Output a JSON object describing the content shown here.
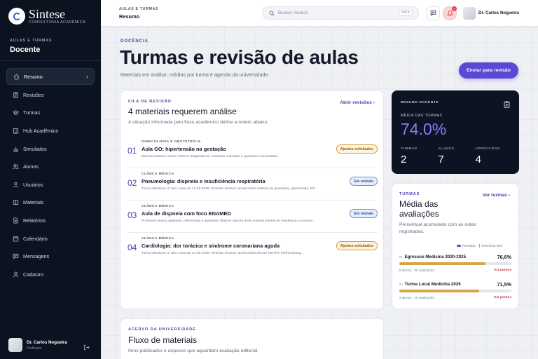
{
  "brand": {
    "name": "Sintese",
    "subtitle": "CONSULTORIA ACADÊMICA"
  },
  "sidebar": {
    "eyebrow": "AULAS E TURMAS",
    "role": "Docente",
    "items": [
      {
        "label": "Resumo",
        "icon": "home-icon",
        "active": true
      },
      {
        "label": "Revisões",
        "icon": "clipboard-icon"
      },
      {
        "label": "Turmas",
        "icon": "graduation-cap-icon"
      },
      {
        "label": "Hub Acadêmico",
        "icon": "building-icon"
      },
      {
        "label": "Simulados",
        "icon": "bar-chart-icon"
      },
      {
        "label": "Alunos",
        "icon": "users-icon"
      },
      {
        "label": "Usuários",
        "icon": "user-group-icon"
      },
      {
        "label": "Materiais",
        "icon": "book-icon"
      },
      {
        "label": "Relatórios",
        "icon": "file-text-icon"
      },
      {
        "label": "Calendário",
        "icon": "calendar-icon"
      },
      {
        "label": "Mensagens",
        "icon": "message-icon"
      },
      {
        "label": "Cadastro",
        "icon": "user-icon"
      }
    ],
    "user": {
      "name": "Dr. Carlos Nogueira",
      "role": "Professor"
    }
  },
  "topbar": {
    "eyebrow": "AULAS E TURMAS",
    "title": "Resumo",
    "search_placeholder": "Buscar módulo",
    "search_shortcut": "Ctrl K",
    "notifications_count": "4",
    "user_name": "Dr. Carlos Nogueira"
  },
  "page": {
    "eyebrow": "DOCÊNCIA",
    "title": "Turmas e revisão de aulas",
    "subtitle": "Materiais em análise, médias por turma e agenda da universidade.",
    "primary_action": "Enviar para revisão"
  },
  "review_queue": {
    "eyebrow": "FILA DE REVISÃO",
    "title": "4 materiais requerem análise",
    "subtitle": "A situação informada pelo fluxo acadêmico define a ordem abaixo.",
    "link": "Abrir revisões",
    "items": [
      {
        "num": "01",
        "category": "GINECOLOGIA E OBSTETRÍCIA",
        "title": "Aula GO: hipertensão na gestação",
        "desc": "Marcos solicitou inserir critérios diagnósticos, condutas cobradas e questões comentadas.",
        "status": "Ajustes solicitados",
        "status_type": "warn"
      },
      {
        "num": "02",
        "category": "CLÍNICA MÉDICA",
        "title": "Pneumologia: dispneia e insuficiência respiratória",
        "desc": "Turma Medicina 3º ano / aula de 12-02-2026. Revisão Sintese: acrescentar critérios de gravidade, gasometria, DT...",
        "status": "Em revisão",
        "status_type": "info"
      },
      {
        "num": "03",
        "category": "CLÍNICA MÉDICA",
        "title": "Aula de dispneia com foco ENAMED",
        "desc": "Professor enviou objetivos, referências e questões. Marcos Jacinto deve orientar pontos de residência a acresce...",
        "status": "Em revisão",
        "status_type": "info"
      },
      {
        "num": "04",
        "category": "CLÍNICA MÉDICA",
        "title": "Cardiologia: dor torácica e síndrome coronariana aguda",
        "desc": "Turma Medicina 3º ano / aula de 14-02-2026. Revisão Sintese: acrescentar escore HEART, eletrocardiog...",
        "status": "Ajustes solicitados",
        "status_type": "warn"
      }
    ]
  },
  "summary": {
    "eyebrow": "RESUMO DOCENTE",
    "metric_label": "MÉDIA DAS TURMAS",
    "metric_value": "74.0%",
    "stats": [
      {
        "label": "TURMAS",
        "value": "2"
      },
      {
        "label": "ALUNOS",
        "value": "7"
      },
      {
        "label": "APROVADOS",
        "value": "4"
      }
    ]
  },
  "averages": {
    "eyebrow": "TURMAS",
    "title": "Média das avaliações",
    "subtitle": "Percentual acumulado com as notas registradas.",
    "link": "Ver turmas",
    "legend": {
      "result": "Resultado",
      "reference": "Referência 80%"
    },
    "classes": [
      {
        "idx": "01",
        "name": "Egressos Medicina 2020-2025",
        "value": "76,6%",
        "fraction": 0.766,
        "meta": "5 alunos · 25 avaliações",
        "delta": "-3,4 pontos"
      },
      {
        "idx": "02",
        "name": "Turma Local Medicina 2026",
        "value": "71,5%",
        "fraction": 0.715,
        "meta": "2 alunos · 16 avaliações",
        "delta": "-8,5 pontos"
      }
    ]
  },
  "collection": {
    "eyebrow": "ACERVO DA UNIVERSIDADE",
    "title": "Fluxo de materiais",
    "subtitle": "Itens publicados e arquivos que aguardam avaliação editorial."
  },
  "colors": {
    "accent": "#5b48d6",
    "sidebar": "#0b1220",
    "warn": "#d99a34",
    "info": "#6b8fd6",
    "danger": "#c8333f"
  }
}
